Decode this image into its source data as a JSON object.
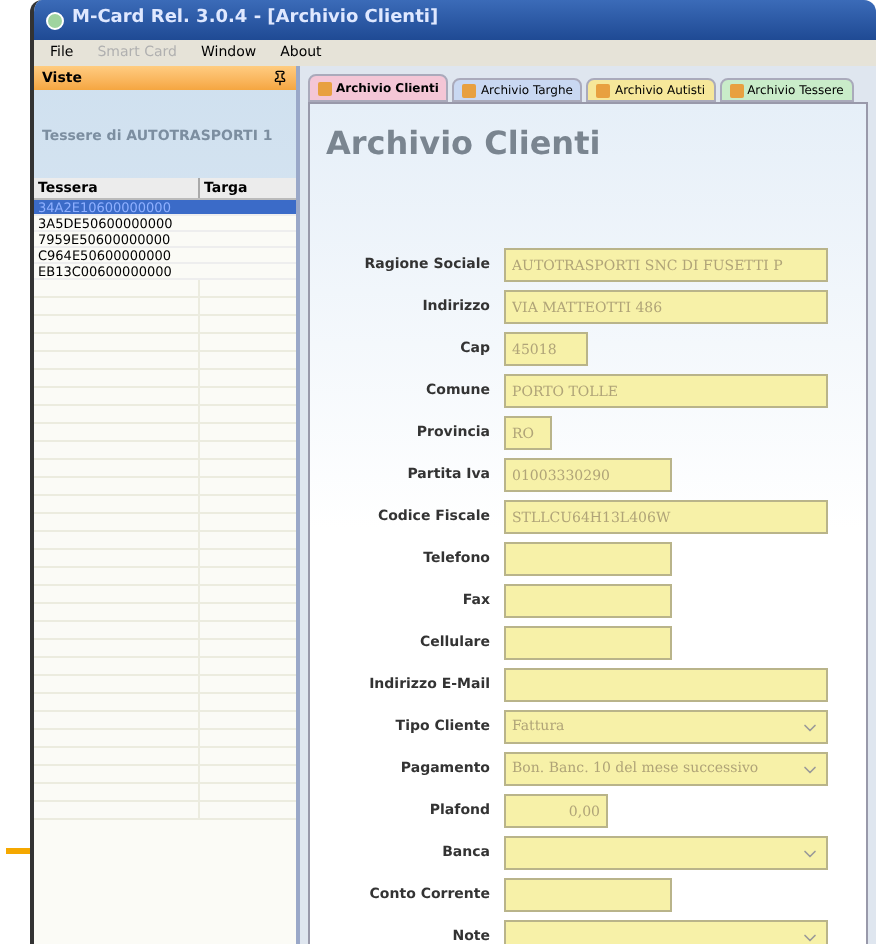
{
  "window": {
    "title": "M-Card Rel. 3.0.4 - [Archivio Clienti]"
  },
  "menu": [
    {
      "label": "File",
      "disabled": false
    },
    {
      "label": "Smart Card",
      "disabled": true
    },
    {
      "label": "Window",
      "disabled": false
    },
    {
      "label": "About",
      "disabled": false
    }
  ],
  "sidebar": {
    "title": "Viste",
    "subtitle": "Tessere di  AUTOTRASPORTI 1",
    "columns": [
      "Tessera",
      "Targa"
    ],
    "rows": [
      {
        "tessera": "34A2E10600000000",
        "selected": true
      },
      {
        "tessera": "3A5DE50600000000",
        "selected": false
      },
      {
        "tessera": "7959E50600000000",
        "selected": false
      },
      {
        "tessera": "C964E50600000000",
        "selected": false
      },
      {
        "tessera": "EB13C00600000000",
        "selected": false
      }
    ]
  },
  "tabs": [
    {
      "label": "Archivio Clienti",
      "selected": true,
      "color": "#f4c6d6"
    },
    {
      "label": "Archivio Targhe",
      "selected": false,
      "color": "#c9d8f2"
    },
    {
      "label": "Archivio Autisti",
      "selected": false,
      "color": "#f6e79a"
    },
    {
      "label": "Archivio Tessere",
      "selected": false,
      "color": "#c9ecc9"
    }
  ],
  "form": {
    "title": "Archivio Clienti",
    "fields": [
      {
        "label": "Ragione Sociale",
        "kind": "text",
        "value": "AUTOTRASPORTI SNC DI FUSETTI P"
      },
      {
        "label": "Indirizzo",
        "kind": "text",
        "value": "VIA MATTEOTTI 486"
      },
      {
        "label": "Cap",
        "kind": "text",
        "value": "45018"
      },
      {
        "label": "Comune",
        "kind": "text",
        "value": "PORTO TOLLE"
      },
      {
        "label": "Provincia",
        "kind": "text",
        "value": "RO"
      },
      {
        "label": "Partita Iva",
        "kind": "text",
        "value": "01003330290"
      },
      {
        "label": "Codice Fiscale",
        "kind": "text",
        "value": "STLLCU64H13L406W"
      },
      {
        "label": "Telefono",
        "kind": "text"
      },
      {
        "label": "Fax",
        "kind": "text"
      },
      {
        "label": "Cellulare",
        "kind": "text"
      },
      {
        "label": "Indirizzo E-Mail",
        "kind": "text"
      },
      {
        "label": "Tipo Cliente",
        "kind": "select",
        "value": "Fattura"
      },
      {
        "label": "Pagamento",
        "kind": "select",
        "value": "Bon. Banc. 10 del mese successivo"
      },
      {
        "label": "Plafond",
        "kind": "number",
        "value": "0,00"
      },
      {
        "label": "Banca",
        "kind": "select"
      },
      {
        "label": "Conto Corrente",
        "kind": "text"
      },
      {
        "label": "Note",
        "kind": "select"
      }
    ]
  }
}
